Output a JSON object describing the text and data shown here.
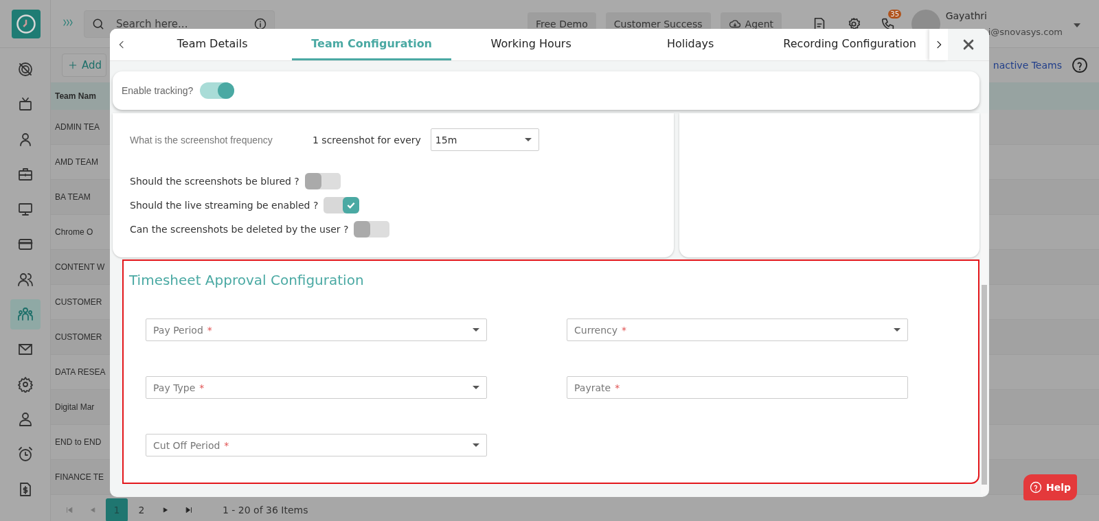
{
  "header": {
    "search_placeholder": "Search here...",
    "buttons": [
      {
        "label": "Free Demo",
        "kind": "plain"
      },
      {
        "label": "Customer Success",
        "kind": "plain"
      },
      {
        "label": "Agent",
        "kind": "cloud"
      }
    ],
    "notification_count": "35",
    "user": {
      "name": "Gayathri",
      "email": "i@snovasys.com"
    }
  },
  "sidebar": {
    "items": [
      {
        "selected": false
      },
      {
        "selected": false
      },
      {
        "selected": false
      },
      {
        "selected": false
      },
      {
        "selected": false
      },
      {
        "selected": false
      },
      {
        "selected": false
      },
      {
        "selected": true
      },
      {
        "selected": false
      },
      {
        "selected": false
      },
      {
        "selected": false
      },
      {
        "selected": false
      },
      {
        "selected": false
      }
    ]
  },
  "toolbar": {
    "add_button": "Add",
    "inactive_link": "nactive Teams"
  },
  "table": {
    "columns": [
      "Team Nam"
    ],
    "rows": [
      "ADMIN TEA",
      "AMD TEAM",
      "BA TEAM",
      "Chrome O",
      "CONTENT W",
      "CUSTOMER",
      "CUSTOMER",
      "DATA RESEA",
      "Digital Mar",
      "END to END",
      "FINANCE TE"
    ]
  },
  "pagination": {
    "pages": [
      {
        "label": "1",
        "selected": true
      },
      {
        "label": "2",
        "selected": false
      }
    ],
    "summary": "1 - 20 of 36 Items"
  },
  "modal": {
    "tabs": [
      {
        "label": "Team Details",
        "selected": false
      },
      {
        "label": "Team Configuration",
        "selected": true
      },
      {
        "label": "Working Hours",
        "selected": false
      },
      {
        "label": "Holidays",
        "selected": false
      },
      {
        "label": "Recording Configuration",
        "selected": false
      }
    ],
    "tracking": {
      "label": "Enable tracking?",
      "on": true
    },
    "screenshot_settings": {
      "question": "What is the screenshot frequency",
      "prefix": "1 screenshot for every",
      "value": "15m",
      "toggles": [
        {
          "label": "Should the screenshots be blured ?",
          "on": false
        },
        {
          "label": "Should the live streaming be enabled ?",
          "on": true
        },
        {
          "label": "Can the screenshots be deleted by the user ?",
          "on": false
        }
      ]
    },
    "timesheet": {
      "title": "Timesheet Approval Configuration",
      "fields": [
        {
          "label": "Pay Period",
          "marker": "*",
          "kind": "select"
        },
        {
          "label": "Currency",
          "marker": "*",
          "kind": "select"
        },
        {
          "label": "Pay Type",
          "marker": "*",
          "kind": "select"
        },
        {
          "label": "Payrate",
          "marker": "*",
          "kind": "text"
        },
        {
          "label": "Cut Off Period",
          "marker": "*",
          "kind": "select"
        }
      ]
    }
  },
  "help_button": "Help"
}
